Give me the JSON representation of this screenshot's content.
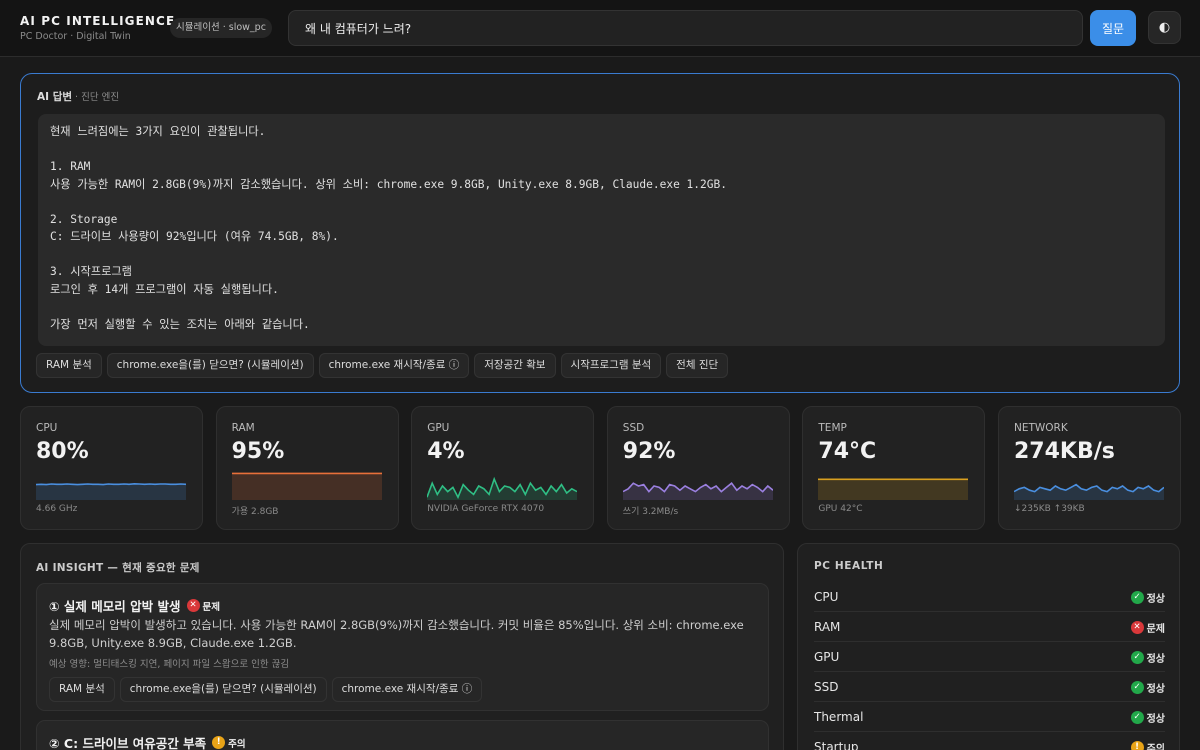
{
  "header": {
    "title": "AI PC INTELLIGENCE",
    "subtitle": "PC Doctor · Digital Twin",
    "sim_badge": "시뮬레이션 · slow_pc",
    "query_value": "왜 내 컴퓨터가 느려?",
    "ask_label": "질문",
    "theme_icon": "◐"
  },
  "answer": {
    "label": "AI 답변",
    "engine": " · 진단 엔진",
    "text": "현재 느려짐에는 3가지 요인이 관찰됩니다.\n\n1. RAM\n사용 가능한 RAM이 2.8GB(9%)까지 감소했습니다. 상위 소비: chrome.exe 9.8GB, Unity.exe 8.9GB, Claude.exe 1.2GB.\n\n2. Storage\nC: 드라이브 사용량이 92%입니다 (여유 74.5GB, 8%).\n\n3. 시작프로그램\n로그인 후 14개 프로그램이 자동 실행됩니다.\n\n가장 먼저 실행할 수 있는 조치는 아래와 같습니다.",
    "chips": [
      "RAM 분석",
      "chrome.exe을(를) 닫으면? (시뮬레이션)",
      "chrome.exe 재시작/종료 ⓘ",
      "저장공간 확보",
      "시작프로그램 분석",
      "전체 진단"
    ]
  },
  "metrics": [
    {
      "label": "CPU",
      "value": "80%",
      "sub": "4.66 GHz",
      "color": "#4a8fe0"
    },
    {
      "label": "RAM",
      "value": "95%",
      "sub": "가용 2.8GB",
      "color": "#e8703a"
    },
    {
      "label": "GPU",
      "value": "4%",
      "sub": "NVIDIA GeForce RTX 4070",
      "color": "#2fbf85"
    },
    {
      "label": "SSD",
      "value": "92%",
      "sub": "쓰기 3.2MB/s",
      "color": "#9b80e0"
    },
    {
      "label": "TEMP",
      "value": "74°C",
      "sub": "GPU 42°C",
      "color": "#d9a020"
    },
    {
      "label": "NETWORK",
      "value": "274KB/s",
      "sub": "↓235KB ↑39KB",
      "color": "#4a8fe0"
    }
  ],
  "insight": {
    "title": "AI INSIGHT — 현재 중요한 문제",
    "issues": [
      {
        "title": "① 실제 메모리 압박 발생",
        "badge": "문제",
        "desc": "실제 메모리 압박이 발생하고 있습니다. 사용 가능한 RAM이 2.8GB(9%)까지 감소했습니다. 커밋 비율은 85%입니다. 상위 소비: chrome.exe 9.8GB, Unity.exe 8.9GB, Claude.exe 1.2GB.",
        "impact": "예상 영향: 멀티태스킹 지연, 페이지 파일 스왑으로 인한 끊김",
        "chips": [
          "RAM 분석",
          "chrome.exe을(를) 닫으면? (시뮬레이션)",
          "chrome.exe 재시작/종료 ⓘ"
        ]
      },
      {
        "title": "② C: 드라이브 여유공간 부족",
        "badge": "주의"
      }
    ]
  },
  "health": {
    "title": "PC HEALTH",
    "rows": [
      {
        "name": "CPU",
        "status": "정상",
        "level": "ok"
      },
      {
        "name": "RAM",
        "status": "문제",
        "level": "bad"
      },
      {
        "name": "GPU",
        "status": "정상",
        "level": "ok"
      },
      {
        "name": "SSD",
        "status": "정상",
        "level": "ok"
      },
      {
        "name": "Thermal",
        "status": "정상",
        "level": "ok"
      },
      {
        "name": "Startup",
        "status": "주의",
        "level": "warn"
      }
    ]
  },
  "colors": {
    "accent": "#3b8ee8",
    "ok": "#22a84a",
    "bad": "#d9383a",
    "warn": "#e8a317"
  }
}
